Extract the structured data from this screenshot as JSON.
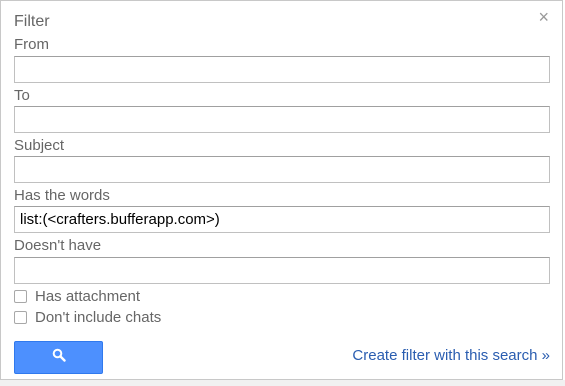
{
  "dialog": {
    "title": "Filter",
    "close_icon": "×"
  },
  "fields": [
    {
      "label": "From",
      "value": ""
    },
    {
      "label": "To",
      "value": ""
    },
    {
      "label": "Subject",
      "value": ""
    },
    {
      "label": "Has the words",
      "value": "list:(<crafters.bufferapp.com>)"
    },
    {
      "label": "Doesn't have",
      "value": ""
    }
  ],
  "checkboxes": [
    {
      "label": "Has attachment",
      "checked": false
    },
    {
      "label": "Don't include chats",
      "checked": false
    }
  ],
  "actions": {
    "search_icon": "search-icon",
    "create_filter_label": "Create filter with this search »"
  },
  "colors": {
    "accent": "#4d90fe",
    "link": "#2a5db0"
  }
}
